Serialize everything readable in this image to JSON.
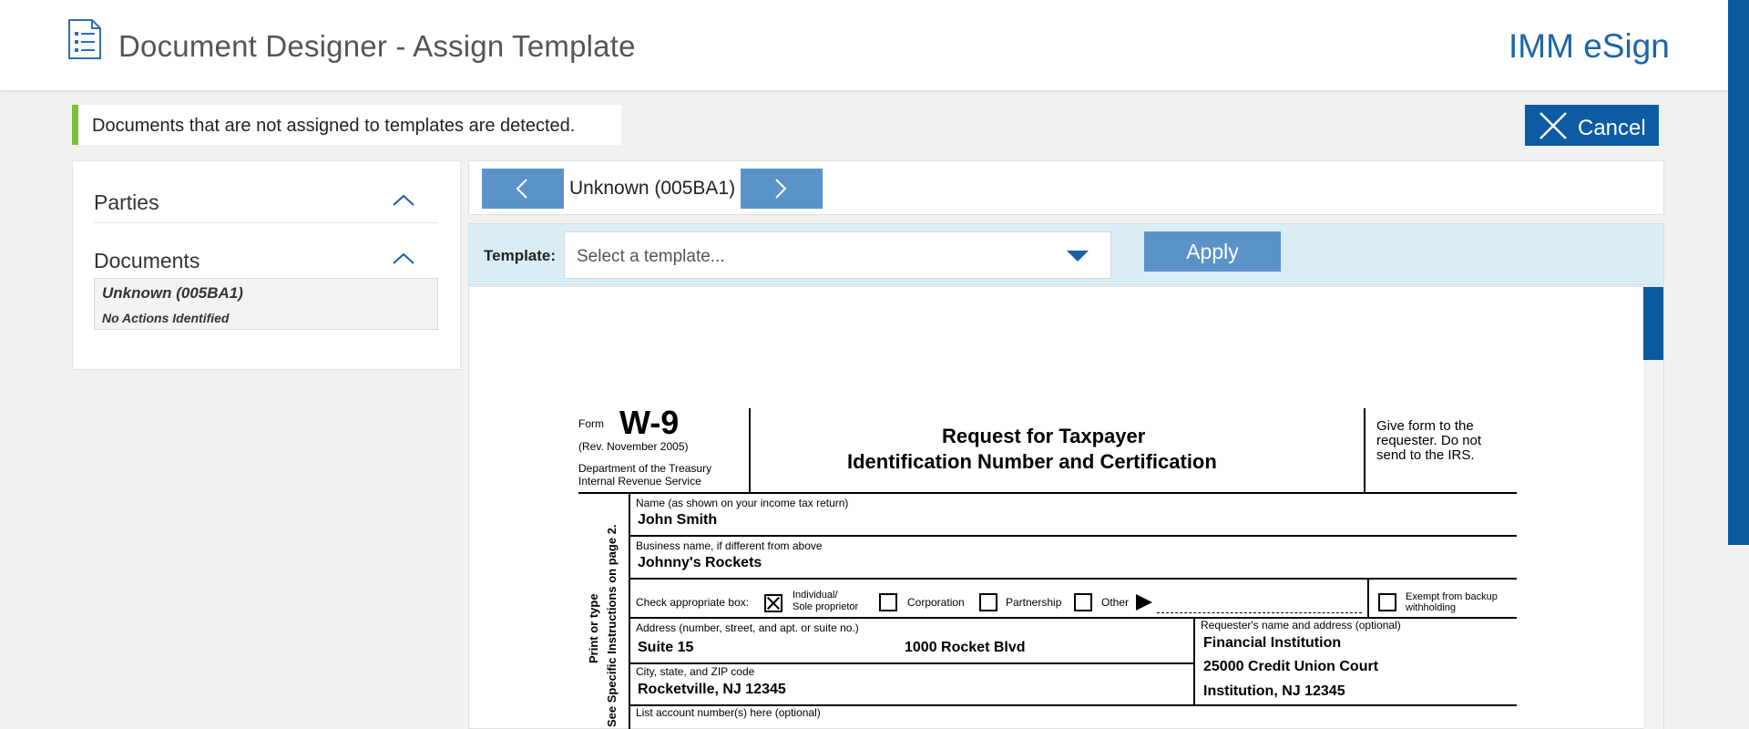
{
  "header": {
    "title": "Document Designer - Assign Template",
    "brand": "IMM eSign",
    "icon": "document-list-icon"
  },
  "notice": {
    "text": "Documents that are not assigned to templates are detected."
  },
  "actions": {
    "cancel_label": "Cancel"
  },
  "sidebar": {
    "sections": [
      {
        "label": "Parties"
      },
      {
        "label": "Documents"
      }
    ],
    "documents": [
      {
        "name": "Unknown (005BA1)",
        "status": "No Actions Identified"
      }
    ]
  },
  "nav": {
    "current_document": "Unknown (005BA1)"
  },
  "template": {
    "label": "Template:",
    "placeholder": "Select a template...",
    "apply_label": "Apply"
  },
  "form": {
    "form_word": "Form",
    "form_number": "W-9",
    "revision": "(Rev. November 2005)",
    "department": "Department of the Treasury",
    "irs": "Internal Revenue Service",
    "title_line1": "Request for Taxpayer",
    "title_line2": "Identification Number and Certification",
    "give_form_1": "Give form to the",
    "give_form_2": "requester. Do not",
    "give_form_3": "send to the IRS.",
    "side_text_1": "Print or type",
    "side_text_2": "See Specific Instructions on page 2.",
    "name_label": "Name (as shown on your income tax return)",
    "name_value": "John Smith",
    "business_label": "Business name, if different from above",
    "business_value": "Johnny's Rockets",
    "check_label": "Check appropriate box:",
    "check_individual_1": "Individual/",
    "check_individual_2": "Sole proprietor",
    "check_corporation": "Corporation",
    "check_partnership": "Partnership",
    "check_other": "Other",
    "exempt_1": "Exempt from backup",
    "exempt_2": "withholding",
    "address_label": "Address (number, street, and apt. or suite no.)",
    "address_suite": "Suite 15",
    "address_street": "1000 Rocket Blvd",
    "requester_label": "Requester's name and address (optional)",
    "requester_1": "Financial Institution",
    "requester_2": "25000 Credit Union Court",
    "requester_3": "Institution, NJ 12345",
    "city_label": "City, state, and ZIP code",
    "city_value": "Rocketville, NJ 12345",
    "account_label": "List account number(s) here (optional)"
  }
}
